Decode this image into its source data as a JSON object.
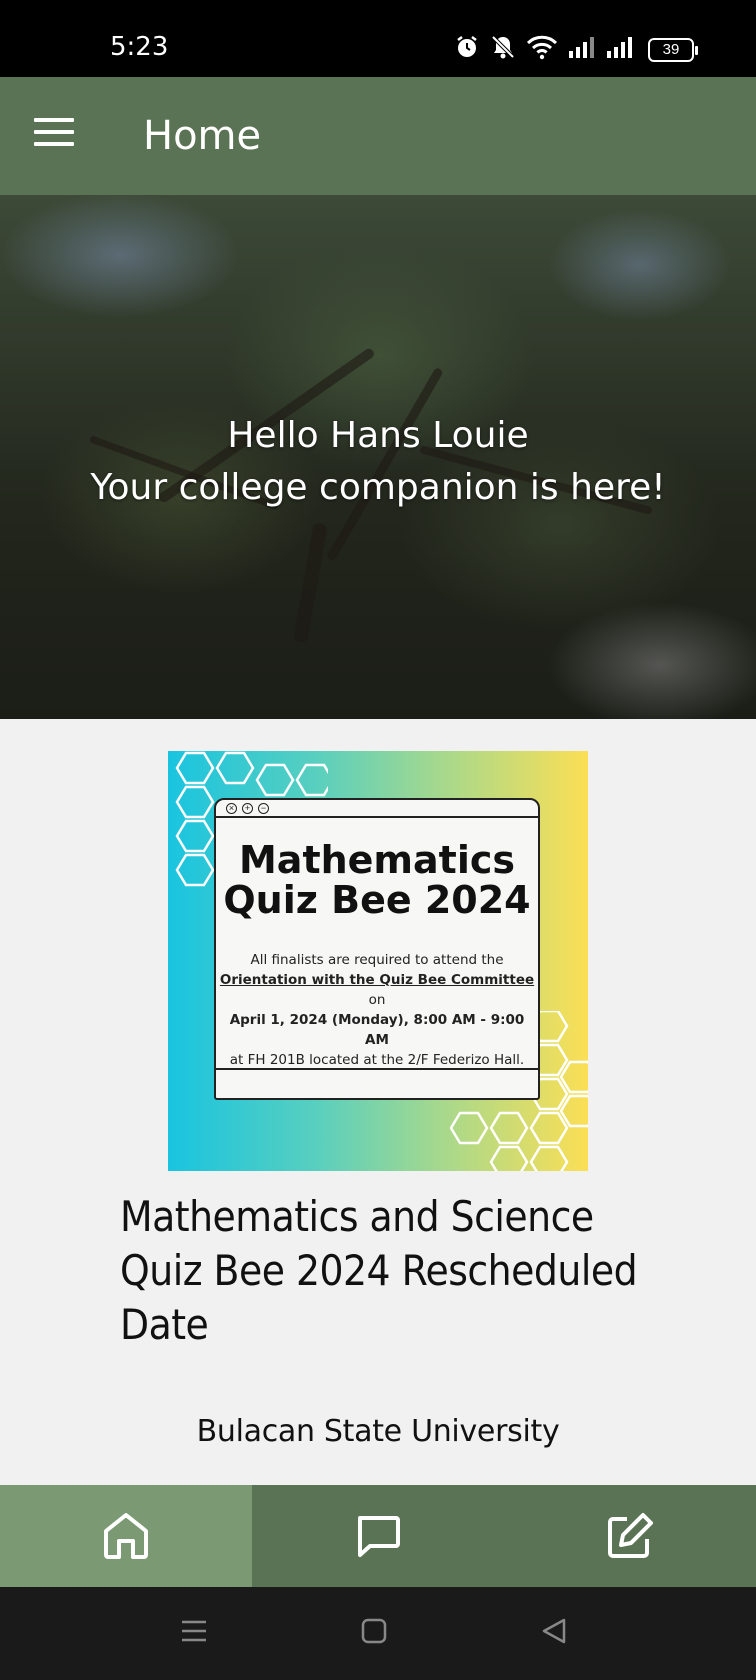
{
  "status_bar": {
    "time": "5:23",
    "battery": "39",
    "icons": [
      "alarm-icon",
      "mute-icon",
      "wifi-icon",
      "signal-icon",
      "signal-icon",
      "battery-icon"
    ]
  },
  "app_bar": {
    "title": "Home",
    "menu_icon": "hamburger-menu-icon"
  },
  "hero": {
    "greeting": "Hello Hans Louie",
    "tagline": "Your college companion is here!"
  },
  "post": {
    "poster": {
      "title_line1": "Mathematics",
      "title_line2": "Quiz Bee 2024",
      "body_line1": "All finalists are required to attend the",
      "body_link": "Orientation with the Quiz Bee Committee",
      "body_on": " on",
      "body_date": "April 1, 2024 (Monday), 8:00 AM - 9:00 AM",
      "body_line4": "at FH 201B located at the 2/F Federizo Hall."
    },
    "title": "Mathematics and Science Quiz Bee 2024 Rescheduled Date",
    "source": "Bulacan State University"
  },
  "bottom_nav": {
    "items": [
      {
        "icon": "home-icon",
        "active": true
      },
      {
        "icon": "chat-icon",
        "active": false
      },
      {
        "icon": "edit-icon",
        "active": false
      }
    ]
  },
  "colors": {
    "primary": "#5b7355",
    "nav_active": "#7b9a74",
    "background": "#f1f1f1"
  }
}
